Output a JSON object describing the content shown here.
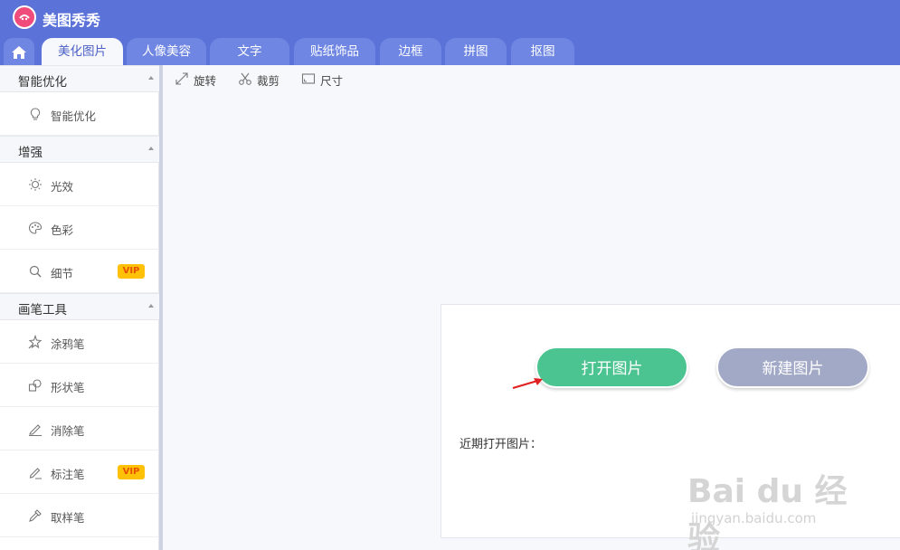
{
  "app": {
    "title": "美图秀秀"
  },
  "tabs": [
    {
      "label": "美化图片",
      "active": true
    },
    {
      "label": "人像美容",
      "active": false
    },
    {
      "label": "文字",
      "active": false
    },
    {
      "label": "贴纸饰品",
      "active": false
    },
    {
      "label": "边框",
      "active": false
    },
    {
      "label": "拼图",
      "active": false
    },
    {
      "label": "抠图",
      "active": false
    }
  ],
  "sidebar": {
    "sections": [
      {
        "title": "智能优化",
        "items": [
          {
            "label": "智能优化",
            "icon": "bulb-icon"
          }
        ]
      },
      {
        "title": "增强",
        "items": [
          {
            "label": "光效",
            "icon": "sun-icon"
          },
          {
            "label": "色彩",
            "icon": "palette-icon"
          },
          {
            "label": "细节",
            "icon": "magnifier-icon",
            "badge": "VIP"
          }
        ]
      },
      {
        "title": "画笔工具",
        "items": [
          {
            "label": "涂鸦笔",
            "icon": "sparkle-brush-icon"
          },
          {
            "label": "形状笔",
            "icon": "shapes-icon"
          },
          {
            "label": "消除笔",
            "icon": "eraser-pen-icon"
          },
          {
            "label": "标注笔",
            "icon": "marker-pen-icon",
            "badge": "VIP"
          },
          {
            "label": "取样笔",
            "icon": "dropper-icon"
          }
        ]
      }
    ]
  },
  "toolbar": {
    "rotate": "旋转",
    "crop": "裁剪",
    "size": "尺寸"
  },
  "panel": {
    "open_label": "打开图片",
    "new_label": "新建图片",
    "recent_label": "近期打开图片："
  },
  "watermark": {
    "line1": "Bai du 经验",
    "line2": "jingyan.baidu.com"
  },
  "colors": {
    "brand": "#5b73d9",
    "open_button": "#4cc491",
    "new_button": "#a2a9c7",
    "vip": "#ffc107"
  }
}
